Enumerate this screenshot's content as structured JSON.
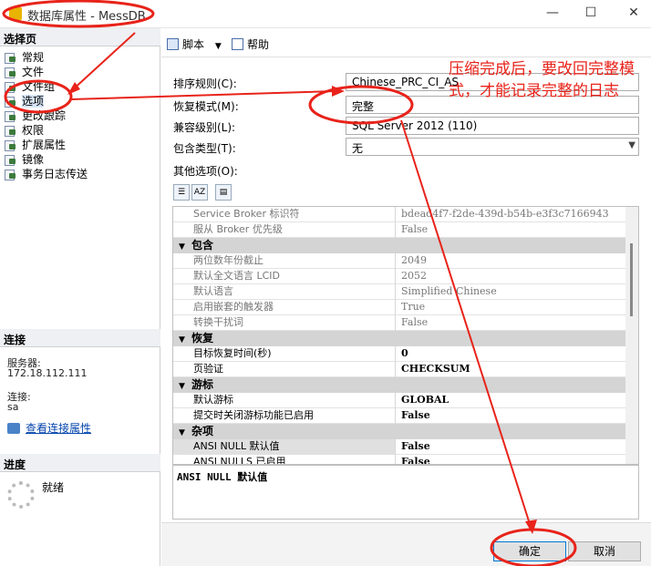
{
  "window": {
    "title": "数据库属性 - MessDB",
    "minimize": "—",
    "maximize": "☐",
    "close": "✕"
  },
  "left_panel": {
    "select_page_header": "选择页",
    "pages": [
      {
        "label": "常规"
      },
      {
        "label": "文件"
      },
      {
        "label": "文件组"
      },
      {
        "label": "选项",
        "selected": true
      },
      {
        "label": "更改跟踪"
      },
      {
        "label": "权限"
      },
      {
        "label": "扩展属性"
      },
      {
        "label": "镜像"
      },
      {
        "label": "事务日志传送"
      }
    ],
    "connection_header": "连接",
    "server_label": "服务器:",
    "server_value": "172.18.112.111",
    "connection_label": "连接:",
    "connection_value": "sa",
    "view_conn_props": "查看连接属性",
    "progress_header": "进度",
    "progress_status": "就绪"
  },
  "toolbar": {
    "script_label": "脚本",
    "help_label": "帮助"
  },
  "form": {
    "collation_label": "排序规则(C):",
    "collation_value": "Chinese_PRC_CI_AS",
    "recovery_label": "恢复模式(M):",
    "recovery_value": "完整",
    "compat_label": "兼容级别(L):",
    "compat_value": "SQL Server 2012 (110)",
    "containment_label": "包含类型(T):",
    "containment_value": "无",
    "other_options_label": "其他选项(O):"
  },
  "grid": {
    "rows": [
      {
        "kind": "prop",
        "name": "Service Broker 标识符",
        "value": "bdead4f7-f2de-439d-b54b-e3f3c7166943",
        "gray": true
      },
      {
        "kind": "prop",
        "name": "服从 Broker 优先级",
        "value": "False",
        "gray": true
      },
      {
        "kind": "cat",
        "name": "包含"
      },
      {
        "kind": "prop",
        "name": "两位数年份截止",
        "value": "2049",
        "gray": true
      },
      {
        "kind": "prop",
        "name": "默认全文语言 LCID",
        "value": "2052",
        "gray": true
      },
      {
        "kind": "prop",
        "name": "默认语言",
        "value": "Simplified Chinese",
        "gray": true
      },
      {
        "kind": "prop",
        "name": "启用嵌套的触发器",
        "value": "True",
        "gray": true
      },
      {
        "kind": "prop",
        "name": "转换干扰词",
        "value": "False",
        "gray": true
      },
      {
        "kind": "cat",
        "name": "恢复"
      },
      {
        "kind": "prop",
        "name": "目标恢复时间(秒)",
        "value": "0",
        "bold": true
      },
      {
        "kind": "prop",
        "name": "页验证",
        "value": "CHECKSUM",
        "bold": true
      },
      {
        "kind": "cat",
        "name": "游标"
      },
      {
        "kind": "prop",
        "name": "默认游标",
        "value": "GLOBAL",
        "bold": true
      },
      {
        "kind": "prop",
        "name": "提交时关闭游标功能已启用",
        "value": "False",
        "bold": true
      },
      {
        "kind": "cat",
        "name": "杂项"
      },
      {
        "kind": "prop",
        "name": "ANSI NULL 默认值",
        "value": "False",
        "bold": true,
        "highlight": true
      },
      {
        "kind": "prop",
        "name": "ANSI NULLS 已启用",
        "value": "False",
        "bold": true
      }
    ],
    "description": "ANSI NULL 默认值"
  },
  "buttons": {
    "ok": "确定",
    "cancel": "取消"
  },
  "annotation": {
    "callout_text": "压缩完成后，要改回完整模式，才能记录完整的日志",
    "color": "#e8231a"
  }
}
